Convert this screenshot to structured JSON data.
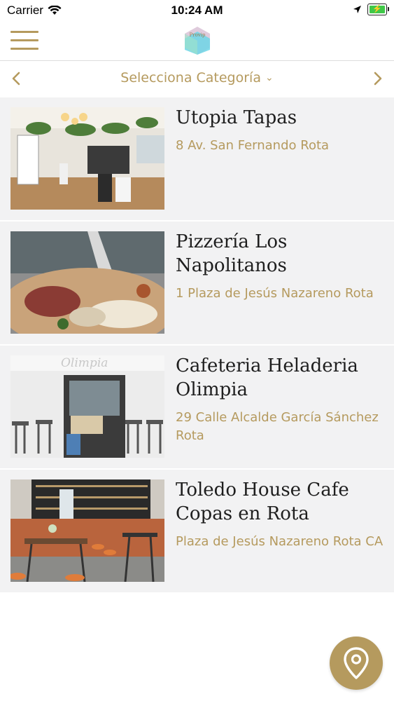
{
  "status_bar": {
    "carrier": "Carrier",
    "time": "10:24 AM"
  },
  "header": {
    "logo_text": "Provip"
  },
  "category_bar": {
    "label": "Selecciona Categoría"
  },
  "colors": {
    "accent": "#b59a5e",
    "list_background": "#f2f2f3",
    "battery": "#3fc848",
    "logo_cyan": "#6fd6e6"
  },
  "icons": {
    "menu": "hamburger-menu-icon",
    "prev": "chevron-left-icon",
    "next": "chevron-right-icon",
    "dropdown": "chevron-down-icon",
    "fab": "map-pin-icon"
  },
  "places": [
    {
      "name": "Utopia Tapas",
      "address": "8 Av. San Fernando Rota"
    },
    {
      "name": "Pizzería Los Napolitanos",
      "address": "1 Plaza de Jesús Nazareno Rota"
    },
    {
      "name": "Cafeteria Heladeria Olimpia",
      "address": "29 Calle Alcalde García Sánchez Rota"
    },
    {
      "name": "Toledo House Cafe Copas en Rota",
      "address": "Plaza de Jesús Nazareno Rota CA"
    }
  ]
}
